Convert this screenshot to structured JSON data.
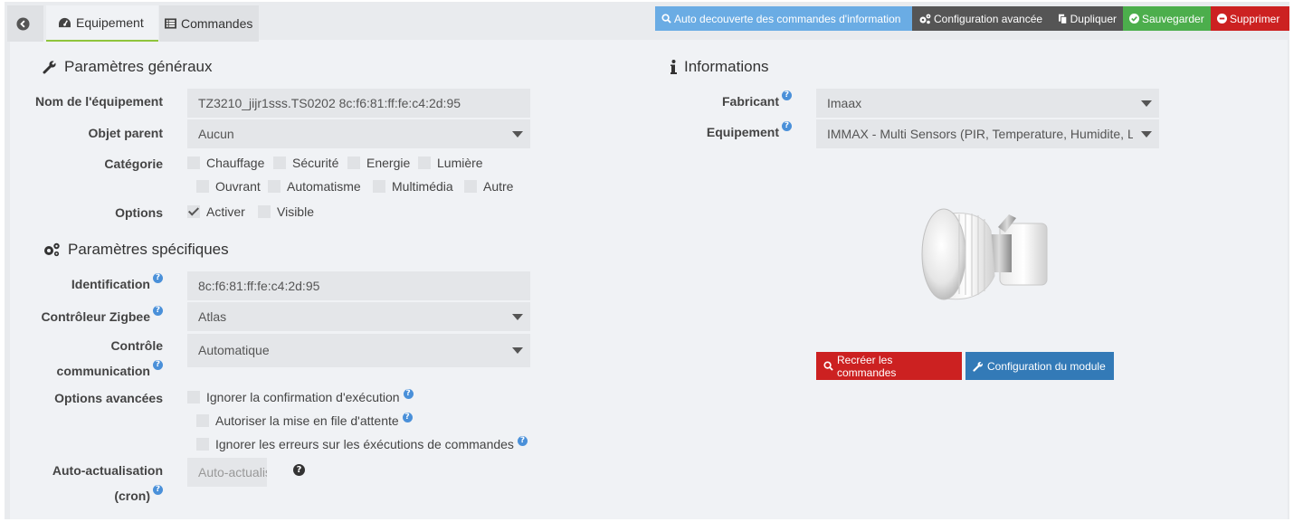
{
  "tabs": {
    "equipement_label": "Equipement",
    "commandes_label": "Commandes"
  },
  "actions": {
    "auto": "Auto decouverte des commandes d'information",
    "config": "Configuration avancée",
    "dup": "Dupliquer",
    "save": "Sauvegarder",
    "del": "Supprimer"
  },
  "general": {
    "title": "Paramètres généraux",
    "name_label": "Nom de l'équipement",
    "name_value": "TZ3210_jijr1sss.TS0202 8c:f6:81:ff:fe:c4:2d:95",
    "parent_label": "Objet parent",
    "parent_value": "Aucun",
    "category_label": "Catégorie",
    "categories": [
      "Chauffage",
      "Sécurité",
      "Energie",
      "Lumière",
      "Ouvrant",
      "Automatisme",
      "Multimédia",
      "Autre"
    ],
    "options_label": "Options",
    "options": [
      "Activer",
      "Visible"
    ]
  },
  "specific": {
    "title": "Paramètres spécifiques",
    "id_label": "Identification",
    "id_value": "8c:f6:81:ff:fe:c4:2d:95",
    "ctrl_label": "Contrôleur Zigbee",
    "ctrl_value": "Atlas",
    "comm_label_1": "Contrôle",
    "comm_label_2": "communication",
    "comm_value": "Automatique",
    "adv_label": "Options avancées",
    "adv_options": [
      "Ignorer la confirmation d'exécution",
      "Autoriser la mise en file d'attente",
      "Ignorer les erreurs sur les éxécutions de commandes"
    ],
    "cron_label_1": "Auto-actualisation",
    "cron_label_2": "(cron)",
    "cron_placeholder": "Auto-actualisation"
  },
  "info": {
    "title": "Informations",
    "manufacturer_label": "Fabricant",
    "manufacturer_value": "Imaax",
    "equipment_label": "Equipement",
    "equipment_value": "IMMAX - Multi Sensors (PIR, Temperature, Humidite, Luminosite)",
    "recreate_btn": "Recréer les commandes",
    "module_btn": "Configuration du module"
  },
  "colors": {
    "auto": "#6aace4",
    "dark": "#555555",
    "save": "#4cae4c",
    "delete": "#cc2121",
    "module": "#337ab7",
    "help": "#4a90d9"
  }
}
